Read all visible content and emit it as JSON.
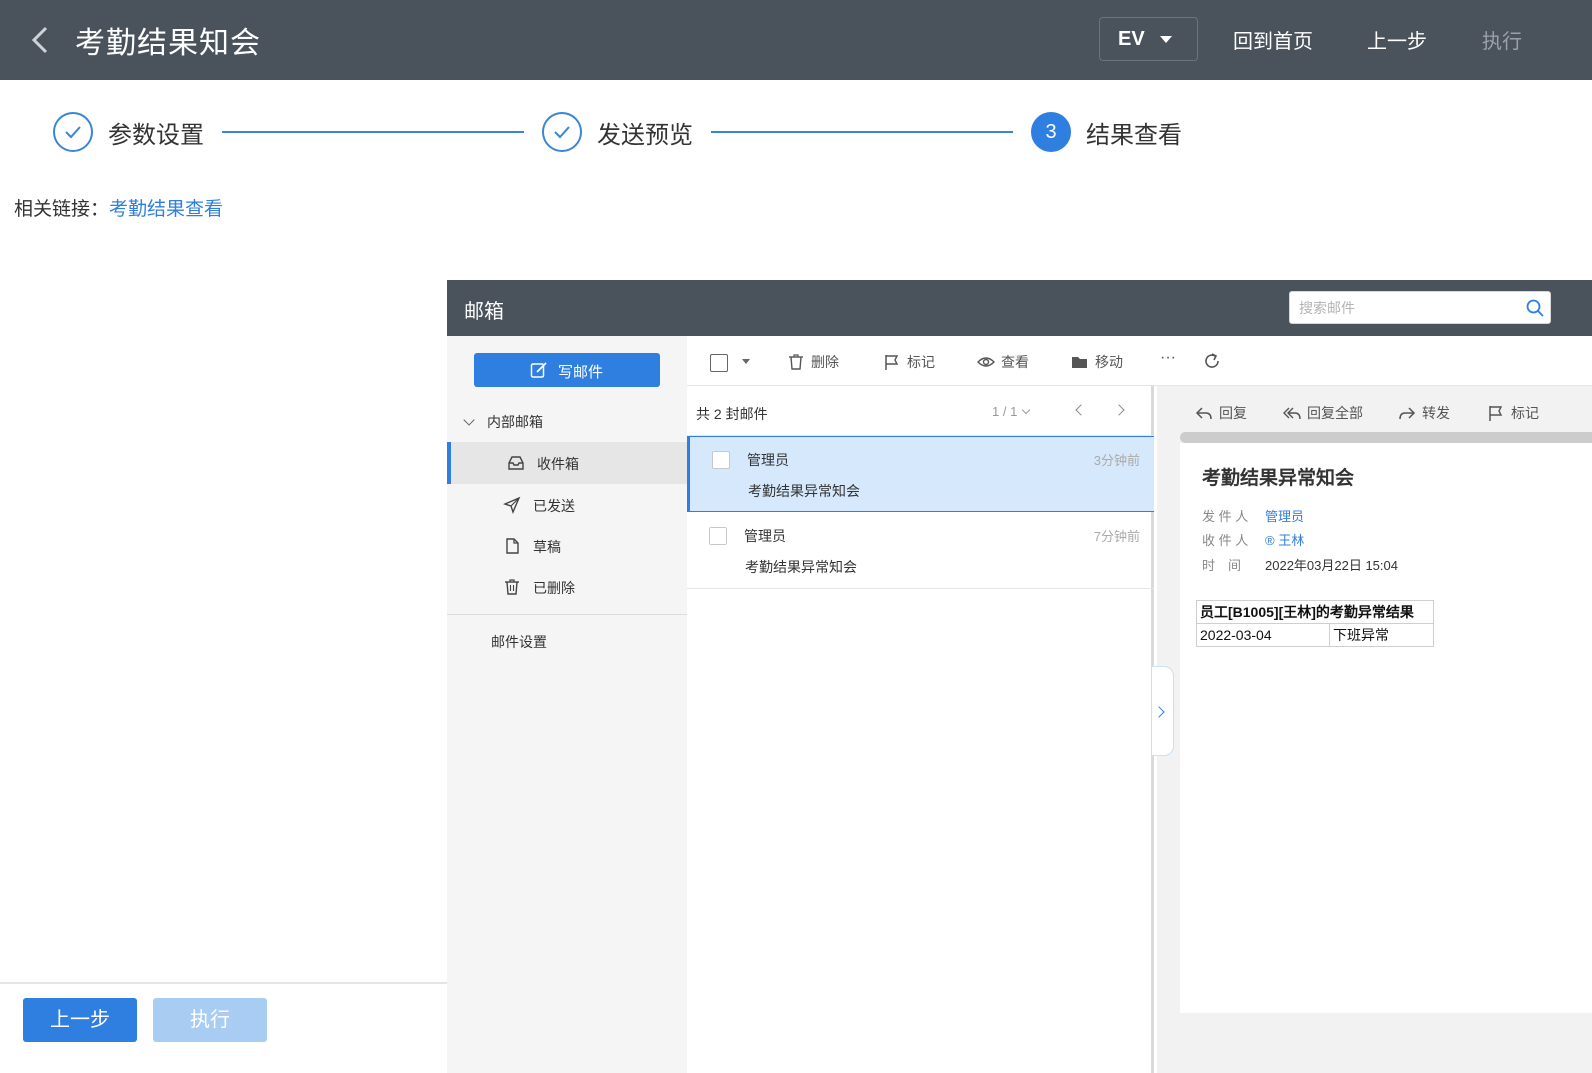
{
  "header": {
    "title": "考勤结果知会",
    "env_selector": "EV",
    "home_button": "回到首页",
    "prev_button": "上一步",
    "exec_button": "执行"
  },
  "steps": [
    {
      "label": "参数设置",
      "state": "done"
    },
    {
      "label": "发送预览",
      "state": "done"
    },
    {
      "label": "结果查看",
      "state": "active",
      "number": "3"
    }
  ],
  "related": {
    "label": "相关链接：",
    "link": "考勤结果查看"
  },
  "footer": {
    "prev_button": "上一步",
    "exec_button": "执行"
  },
  "mailbox": {
    "title": "邮箱",
    "search_placeholder": "搜索邮件",
    "compose_label": "写邮件",
    "group_label": "内部邮箱",
    "folders": [
      {
        "label": "收件箱",
        "icon": "inbox-icon",
        "selected": true
      },
      {
        "label": "已发送",
        "icon": "send-icon",
        "selected": false
      },
      {
        "label": "草稿",
        "icon": "draft-icon",
        "selected": false
      },
      {
        "label": "已删除",
        "icon": "trash-icon",
        "selected": false
      }
    ],
    "settings_label": "邮件设置",
    "toolbar": {
      "delete": "删除",
      "mark": "标记",
      "view": "查看",
      "move": "移动",
      "more": "···"
    },
    "list": {
      "count": "共 2 封邮件",
      "page": "1 / 1",
      "items": [
        {
          "sender": "管理员",
          "subject": "考勤结果异常知会",
          "time": "3分钟前",
          "selected": true
        },
        {
          "sender": "管理员",
          "subject": "考勤结果异常知会",
          "time": "7分钟前",
          "selected": false
        }
      ]
    },
    "reader": {
      "actions": {
        "reply": "回复",
        "reply_all": "回复全部",
        "forward": "转发",
        "mark": "标记"
      },
      "subject": "考勤结果异常知会",
      "sender_label": "发 件 人",
      "sender": "管理员",
      "recipient_label": "收 件 人",
      "recipient": "® 王林",
      "time_label": "时　间",
      "time": "2022年03月22日 15:04",
      "table": {
        "header": "员工[B1005][王林]的考勤异常结果",
        "rows": [
          {
            "date": "2022-03-04",
            "result": "下班异常"
          }
        ]
      }
    }
  },
  "colors": {
    "header_bg": "#4a535c",
    "accent": "#2f7fe0",
    "selected_row": "#d6e8fb",
    "disabled_button": "#a9cdf2"
  }
}
